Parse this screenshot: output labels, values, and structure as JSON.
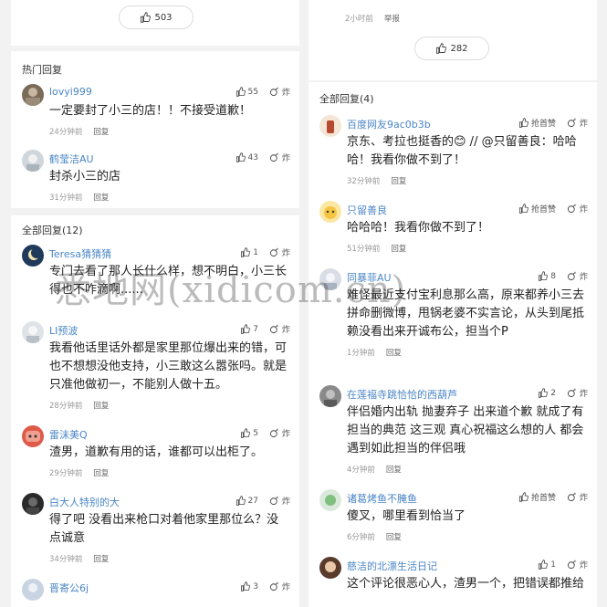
{
  "left": {
    "top_likes": "503",
    "hot_title": "热门回复",
    "all_title": "全部回复(12)",
    "hot": [
      {
        "user": "lovyi999",
        "content": "一定要封了小三的店！！不接受道歉！",
        "likes": "55",
        "fire": "炸",
        "time": "24分钟前",
        "reply": "回复"
      },
      {
        "user": "鹤莹洁AU",
        "content": "封杀小三的店",
        "likes": "43",
        "fire": "炸",
        "time": "31分钟前",
        "reply": "回复"
      }
    ],
    "all": [
      {
        "user": "Teresa猜猜猜",
        "content": "专门去看了那人长什么样，想不明白，小三长得也不咋滴啊......",
        "likes": "1",
        "fire": "炸",
        "time": "",
        "reply": ""
      },
      {
        "user": "LI预波",
        "content": "我看他话里话外都是家里那位爆出来的错，可也不想想没他支持，小三敢这么嚣张吗。就是只准他做初一，不能别人做十五。",
        "likes": "7",
        "fire": "炸",
        "time": "28分钟前",
        "reply": "回复"
      },
      {
        "user": "雷沫美Q",
        "content": "渣男，道歉有用的话，谁都可以出柜了。",
        "likes": "5",
        "fire": "炸",
        "time": "29分钟前",
        "reply": "回复"
      },
      {
        "user": "白大人特别的大",
        "content": "得了吧 没看出来枪口对着他家里那位么？没点诚意",
        "likes": "27",
        "fire": "炸",
        "time": "34分钟前",
        "reply": "回复"
      },
      {
        "user": "晋寄公6j",
        "content": "",
        "likes": "3",
        "fire": "炸",
        "time": "",
        "reply": ""
      }
    ]
  },
  "right": {
    "top_meta_time": "2小时前",
    "top_meta_reply": "举报",
    "top_likes": "282",
    "all_title": "全部回复(4)",
    "comments": [
      {
        "user": "百度网友9ac0b3b",
        "content": "京东、考拉也挺香的😊 // @只留善良：哈哈哈！我看你做不到了！",
        "likes": "抢首赞",
        "fire": "炸",
        "time": "32分钟前",
        "reply": "回复"
      },
      {
        "user": "只留善良",
        "content": "哈哈哈！我看你做不到了！",
        "likes": "抢首赞",
        "fire": "炸",
        "time": "51分钟前",
        "reply": "回复"
      },
      {
        "user": "同暴菲AU",
        "content": "难怪最近支付宝利息那么高，原来都养小三去拼命删微博，甩锅老婆不实言论，从头到尾抵赖没看出来开诚布公，担当个P",
        "likes": "8",
        "fire": "炸",
        "time": "1分钟前",
        "reply": "回复"
      },
      {
        "user": "在莲福寺跳恰恰的西葫芦",
        "content": "伴侣婚内出轨 抛妻弃子 出来道个歉 就成了有担当的典范 这三观 真心祝福这么想的人 都会遇到如此担当的伴侣哦",
        "likes": "2",
        "fire": "炸",
        "time": "4分钟前",
        "reply": "回复"
      },
      {
        "user": "诸葛烤鱼不腌鱼",
        "content": "傻叉，哪里看到恰当了",
        "likes": "抢首赞",
        "fire": "炸",
        "time": "6分钟前",
        "reply": "回复"
      },
      {
        "user": "慈洁的北漂生活日记",
        "content": "这个评论很恶心人，渣男一个，把错误都推给",
        "likes": "1",
        "fire": "炸",
        "time": "",
        "reply": ""
      }
    ]
  },
  "watermark": "悉地网(xidicom.cn)"
}
